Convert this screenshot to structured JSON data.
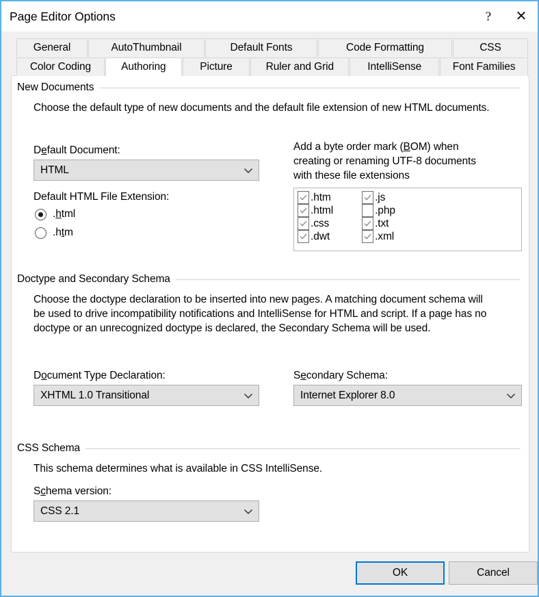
{
  "window": {
    "title": "Page Editor Options",
    "help_glyph": "?",
    "close_glyph": "✕"
  },
  "tabs": {
    "row1": [
      {
        "label": "General",
        "selected": false
      },
      {
        "label": "AutoThumbnail",
        "selected": false
      },
      {
        "label": "Default Fonts",
        "selected": false
      },
      {
        "label": "Code Formatting",
        "selected": false
      },
      {
        "label": "CSS",
        "selected": false
      }
    ],
    "row2": [
      {
        "label": "Color Coding",
        "selected": false
      },
      {
        "label": "Authoring",
        "selected": true
      },
      {
        "label": "Picture",
        "selected": false
      },
      {
        "label": "Ruler and Grid",
        "selected": false
      },
      {
        "label": "IntelliSense",
        "selected": false
      },
      {
        "label": "Font Families",
        "selected": false
      }
    ]
  },
  "new_documents": {
    "group_title": "New Documents",
    "description": "Choose the default type of new documents and the default file extension of new HTML documents.",
    "default_document": {
      "label_pre": "D",
      "label_key": "e",
      "label_post": "fault Document:",
      "value": "HTML"
    },
    "file_extension": {
      "label_pre": "Default HTML File Extension:",
      "options": [
        {
          "pre": ".",
          "key": "h",
          "post": "tml",
          "checked": true
        },
        {
          "pre": ".h",
          "key": "t",
          "post": "m",
          "checked": false
        }
      ]
    },
    "bom": {
      "line1_pre": "Add a byte order mark (",
      "line1_key": "B",
      "line1_post": "OM) when",
      "line2": "creating or renaming UTF-8 documents",
      "line3": "with these file extensions",
      "column1": [
        {
          "label": ".htm",
          "checked": true
        },
        {
          "label": ".html",
          "checked": true
        },
        {
          "label": ".css",
          "checked": true
        },
        {
          "label": ".dwt",
          "checked": true
        }
      ],
      "column2": [
        {
          "label": ".js",
          "checked": true
        },
        {
          "label": ".php",
          "checked": false
        },
        {
          "label": ".txt",
          "checked": true
        },
        {
          "label": ".xml",
          "checked": true
        }
      ]
    }
  },
  "doctype": {
    "group_title": "Doctype and Secondary Schema",
    "description": "Choose the doctype declaration to be inserted into new pages. A matching document schema will be used to drive incompatibility notifications and IntelliSense for HTML and script. If a page has no doctype or an unrecognized doctype is declared, the Secondary Schema will be used.",
    "document_type": {
      "label_pre": "D",
      "label_key": "o",
      "label_post": "cument Type Declaration:",
      "value": "XHTML 1.0 Transitional"
    },
    "secondary_schema": {
      "label_pre": "S",
      "label_key": "e",
      "label_post": "condary Schema:",
      "value": "Internet Explorer 8.0"
    }
  },
  "css_schema": {
    "group_title": "CSS Schema",
    "description": "This schema determines what is available in CSS IntelliSense.",
    "schema_version": {
      "label_pre": "S",
      "label_key": "c",
      "label_post": "hema version:",
      "value": "CSS 2.1"
    }
  },
  "footer": {
    "ok_label": "OK",
    "cancel_label": "Cancel"
  },
  "colors": {
    "window_border": "#5ab0e8",
    "focus_border": "#0078d7",
    "dialog_bg": "#f0f0f0",
    "panel_bg": "#ffffff",
    "control_bg": "#e1e1e1"
  }
}
